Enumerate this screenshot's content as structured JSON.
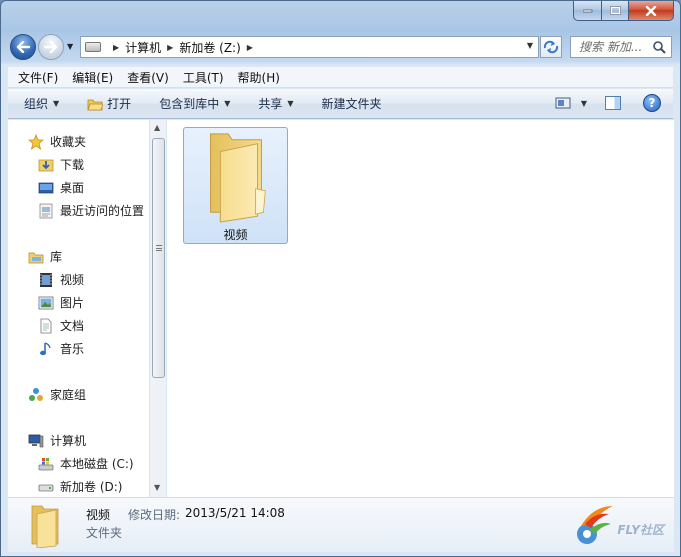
{
  "window": {
    "caption_buttons": [
      "minimize",
      "maximize",
      "close"
    ]
  },
  "nav": {
    "path": [
      "计算机",
      "新加卷 (Z:)"
    ],
    "search_placeholder": "搜索 新加..."
  },
  "menu": [
    "文件(F)",
    "编辑(E)",
    "查看(V)",
    "工具(T)",
    "帮助(H)"
  ],
  "commands": {
    "organize": "组织",
    "open": "打开",
    "include": "包含到库中",
    "share": "共享",
    "new_folder": "新建文件夹"
  },
  "sidebar": {
    "favorites": {
      "label": "收藏夹",
      "items": [
        "下载",
        "桌面",
        "最近访问的位置"
      ]
    },
    "libraries": {
      "label": "库",
      "items": [
        "视频",
        "图片",
        "文档",
        "音乐"
      ]
    },
    "homegroup": "家庭组",
    "computer": {
      "label": "计算机",
      "items": [
        "本地磁盘 (C:)",
        "新加卷 (D:)"
      ]
    }
  },
  "content": {
    "items": [
      {
        "name": "视频",
        "type": "folder"
      }
    ]
  },
  "details": {
    "name": "视频",
    "modified_label": "修改日期:",
    "modified_value": "2013/5/21 14:08",
    "type": "文件夹"
  },
  "watermark": {
    "text": "FLY社区"
  },
  "colors": {
    "accent": "#2f66b3",
    "selection": "#cfe2f8",
    "folder": "#f3d77d"
  }
}
